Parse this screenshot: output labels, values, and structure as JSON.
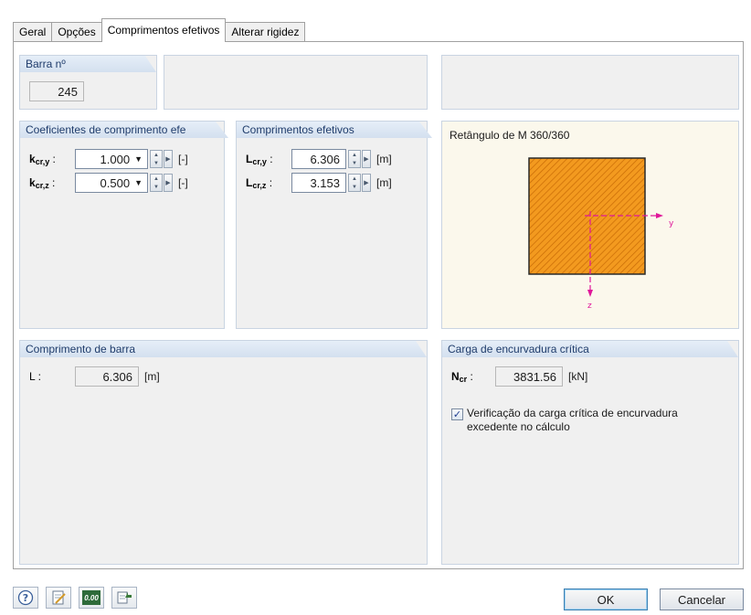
{
  "tabs": [
    {
      "label": "Geral"
    },
    {
      "label": "Opções"
    },
    {
      "label": "Comprimentos efetivos"
    },
    {
      "label": "Alterar rigidez"
    }
  ],
  "member": {
    "header": "Barra nº",
    "value": "245"
  },
  "coefficients": {
    "header": "Coeficientes de comprimento efe",
    "rows": [
      {
        "symbol": "k",
        "sub": "cr,y",
        "suffix": " :",
        "value": "1.000",
        "unit": "[-]"
      },
      {
        "symbol": "k",
        "sub": "cr,z",
        "suffix": " :",
        "value": "0.500",
        "unit": "[-]"
      }
    ]
  },
  "effective": {
    "header": "Comprimentos efetivos",
    "rows": [
      {
        "symbol": "L",
        "sub": "cr,y",
        "suffix": " :",
        "value": "6.306",
        "unit": "[m]"
      },
      {
        "symbol": "L",
        "sub": "cr,z",
        "suffix": " :",
        "value": "3.153",
        "unit": "[m]"
      }
    ]
  },
  "section": {
    "title": "Retângulo de M 360/360",
    "axis_y": "y",
    "axis_z": "z",
    "fill_color": "#f39a1f",
    "axis_color": "#e0189a"
  },
  "member_length": {
    "header": "Comprimento de barra",
    "label": "L :",
    "value": "6.306",
    "unit": "[m]"
  },
  "critical_load": {
    "header": "Carga de encurvadura crítica",
    "symbol": "N",
    "sub": "cr",
    "suffix": " :",
    "value": "3831.56",
    "unit": "[kN]",
    "check_checked": true,
    "check_label": "Verificação da carga crítica de encurvadura excedente no cálculo"
  },
  "buttons": {
    "ok": "OK",
    "cancel": "Cancelar"
  },
  "toolbar_icons": {
    "help": "help-icon",
    "edit": "edit-icon",
    "decimals": "0.00",
    "export": "export-icon"
  }
}
